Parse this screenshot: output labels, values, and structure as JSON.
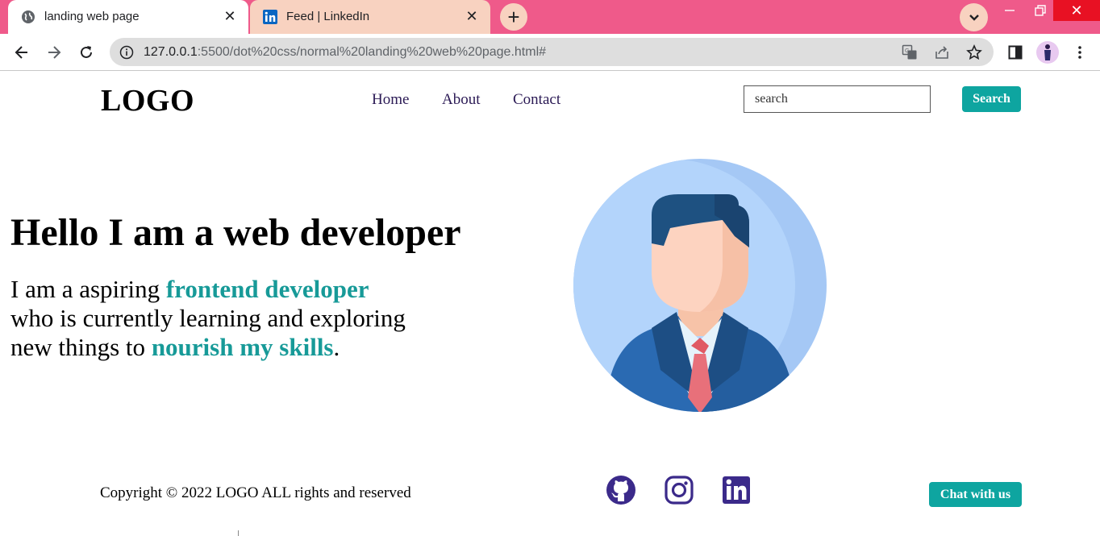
{
  "browser": {
    "tabs": [
      {
        "title": "landing web page",
        "favicon": "globe-icon",
        "active": true
      },
      {
        "title": "Feed | LinkedIn",
        "favicon": "linkedin-icon",
        "active": false
      }
    ],
    "url_host": "127.0.0.1",
    "url_path": ":5500/dot%20css/normal%20landing%20web%20page.html#",
    "colors": {
      "tabbar": "#ef5a8a",
      "inactive_tab": "#f8d2c0",
      "omnibox": "#dedede"
    }
  },
  "header": {
    "logo": "LOGO",
    "nav": [
      "Home",
      "About",
      "Contact"
    ],
    "search_placeholder": "search",
    "search_button": "Search"
  },
  "hero": {
    "title": "Hello I am a web developer",
    "line1_pre": "I am a aspiring ",
    "line1_highlight": "frontend developer",
    "line2": "who is currently learning and exploring",
    "line3_pre": "new things to ",
    "line3_highlight": "nourish my skills",
    "line3_post": ".",
    "image": "developer-avatar-illustration"
  },
  "footer": {
    "copyright": "Copyright © 2022 LOGO ALL rights and reserved",
    "social": [
      "github-icon",
      "instagram-icon",
      "linkedin-icon"
    ],
    "chat_button": "Chat with us"
  },
  "colors": {
    "accent": "#0ea5a0",
    "highlight_text": "#179a98",
    "nav_text": "#2b1a55",
    "social_icons": "#3b2a8a"
  }
}
